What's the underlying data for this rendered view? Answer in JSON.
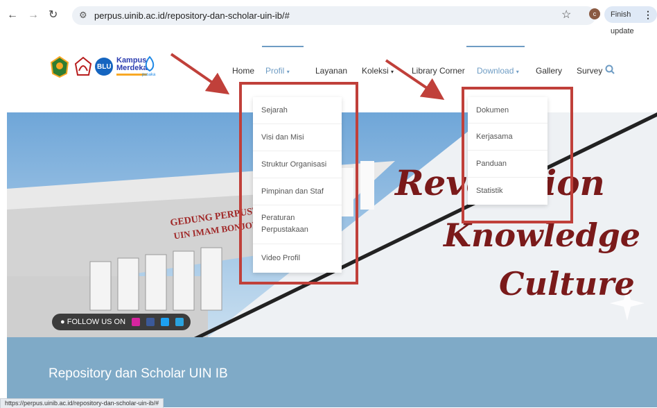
{
  "browser": {
    "url": "perpus.uinib.ac.id/repository-dan-scholar-uin-ib/#",
    "profile_initial": "c",
    "update_button": "Finish update",
    "status_url": "https://perpus.uinib.ac.id/repository-dan-scholar-uin-ib/#"
  },
  "logos": {
    "kampus_line1": "Kampus",
    "kampus_line2": "Merdeka",
    "blu": "BLU",
    "pustaka": "pusaka"
  },
  "nav": {
    "items": [
      "Home",
      "Profil",
      "Layanan",
      "Koleksi",
      "Library Corner",
      "Download",
      "Gallery",
      "Survey"
    ]
  },
  "profil_menu": [
    "Sejarah",
    "Visi dan Misi",
    "Struktur Organisasi",
    "Pimpinan dan Staf",
    "Peraturan Perpustakaan",
    "Video Profil"
  ],
  "download_menu": [
    "Dokumen",
    "Kerjasama",
    "Panduan",
    "Statistik"
  ],
  "hero": {
    "building_sign_line1": "GEDUNG PERPUSTAKAAN",
    "building_sign_line2": "UIN IMAM BONJOL PADANG",
    "slogan_line1": "Revolution",
    "slogan_line2": "Knowledge",
    "slogan_line3": "Culture",
    "follow_label": "FOLLOW US ON"
  },
  "page": {
    "title": "Repository dan Scholar UIN IB"
  },
  "colors": {
    "accent": "#6e9cc4",
    "band": "#7faac7",
    "annotation_red": "#c0403a",
    "slogan": "#7a1a1a"
  }
}
